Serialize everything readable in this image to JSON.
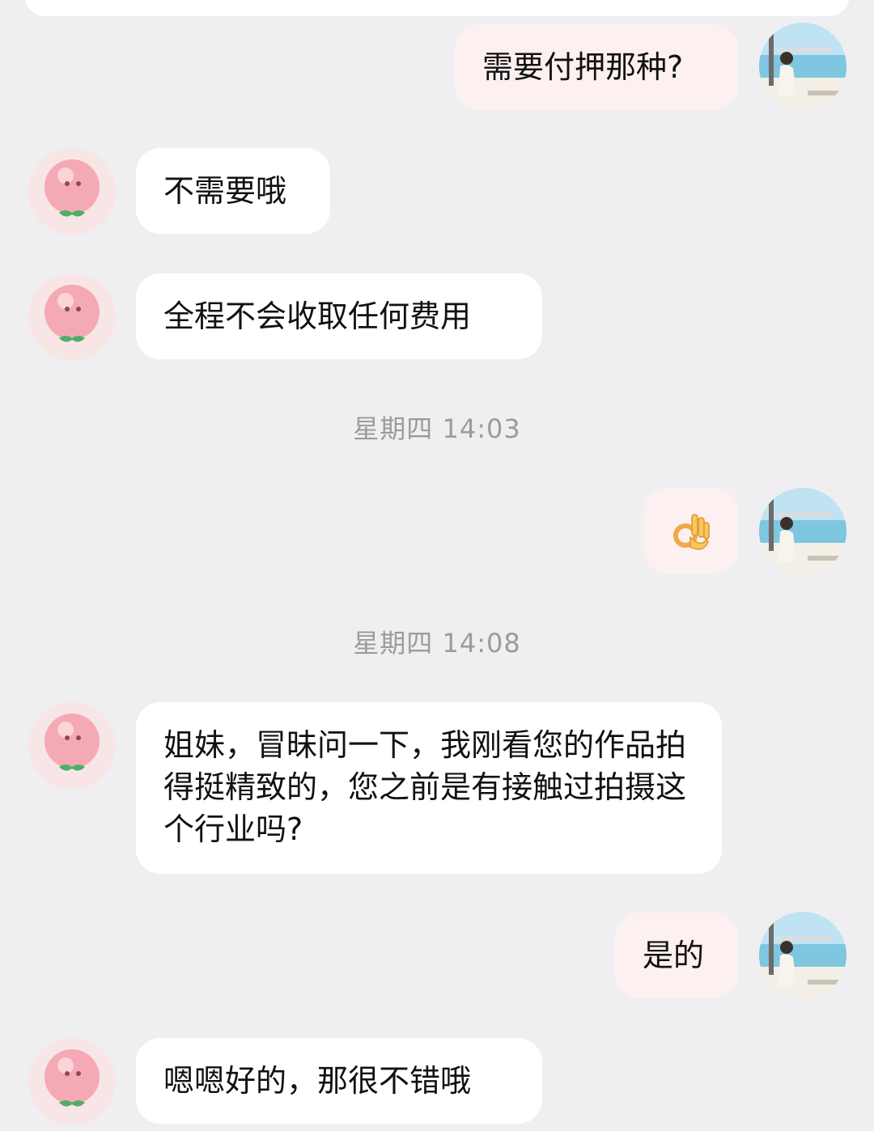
{
  "messages": [
    {
      "text": "需要付押那种?"
    },
    {
      "text": "不需要哦"
    },
    {
      "text": "全程不会收取任何费用"
    },
    {
      "text": "姐妹，冒昧问一下，我刚看您的作品拍得挺精致的，您之前是有接触过拍摄这个行业吗?"
    },
    {
      "text": "是的"
    },
    {
      "text": "嗯嗯好的，那很不错哦"
    }
  ],
  "timestamps": [
    "星期四 14:03",
    "星期四 14:08"
  ],
  "icons": {
    "contact_avatar": "peach-avatar-icon",
    "user_avatar": "seaside-photo-avatar",
    "ok_emoji": "ok-hand-icon"
  },
  "colors": {
    "background": "#efeff1",
    "incoming_bubble": "#ffffff",
    "outgoing_bubble": "#fdf0f0",
    "timestamp_text": "#9b9b9b"
  }
}
